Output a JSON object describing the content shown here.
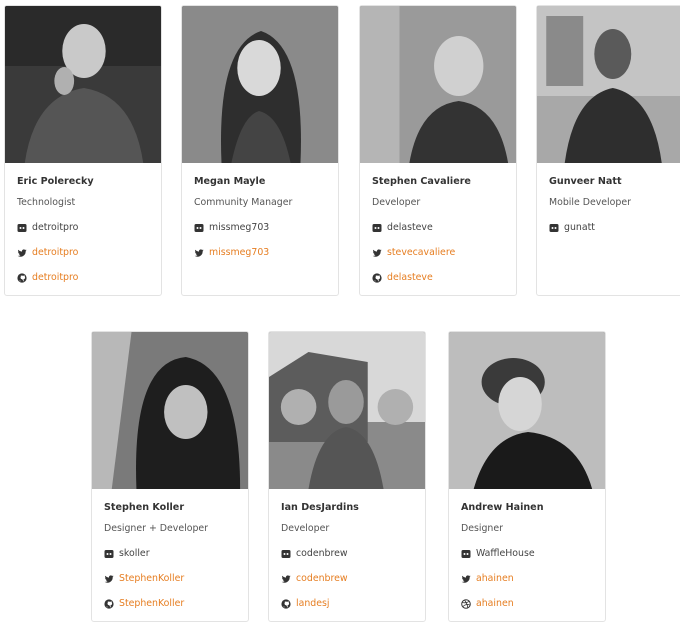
{
  "members": [
    {
      "name": "Eric Polerecky",
      "role": "Technologist",
      "links": [
        {
          "type": "discord",
          "label": "detroitpro"
        },
        {
          "type": "twitter",
          "label": "detroitpro"
        },
        {
          "type": "github",
          "label": "detroitpro"
        }
      ]
    },
    {
      "name": "Megan Mayle",
      "role": "Community Manager",
      "links": [
        {
          "type": "discord",
          "label": "missmeg703"
        },
        {
          "type": "twitter",
          "label": "missmeg703"
        }
      ]
    },
    {
      "name": "Stephen Cavaliere",
      "role": "Developer",
      "links": [
        {
          "type": "discord",
          "label": "delasteve"
        },
        {
          "type": "twitter",
          "label": "stevecavaliere"
        },
        {
          "type": "github",
          "label": "delasteve"
        }
      ]
    },
    {
      "name": "Gunveer Natt",
      "role": "Mobile Developer",
      "links": [
        {
          "type": "discord",
          "label": "gunatt"
        }
      ]
    },
    {
      "name": "Stephen Koller",
      "role": "Designer + Developer",
      "links": [
        {
          "type": "discord",
          "label": "skoller"
        },
        {
          "type": "twitter",
          "label": "StephenKoller"
        },
        {
          "type": "github",
          "label": "StephenKoller"
        }
      ]
    },
    {
      "name": "Ian DesJardins",
      "role": "Developer",
      "links": [
        {
          "type": "discord",
          "label": "codenbrew"
        },
        {
          "type": "twitter",
          "label": "codenbrew"
        },
        {
          "type": "github",
          "label": "landesj"
        }
      ]
    },
    {
      "name": "Andrew Hainen",
      "role": "Designer",
      "links": [
        {
          "type": "discord",
          "label": "WaffleHouse"
        },
        {
          "type": "twitter",
          "label": "ahainen"
        },
        {
          "type": "dribbble",
          "label": "ahainen"
        }
      ]
    }
  ],
  "colors": {
    "link_accent": "#e67e22",
    "card_border": "#e3e3e3"
  }
}
